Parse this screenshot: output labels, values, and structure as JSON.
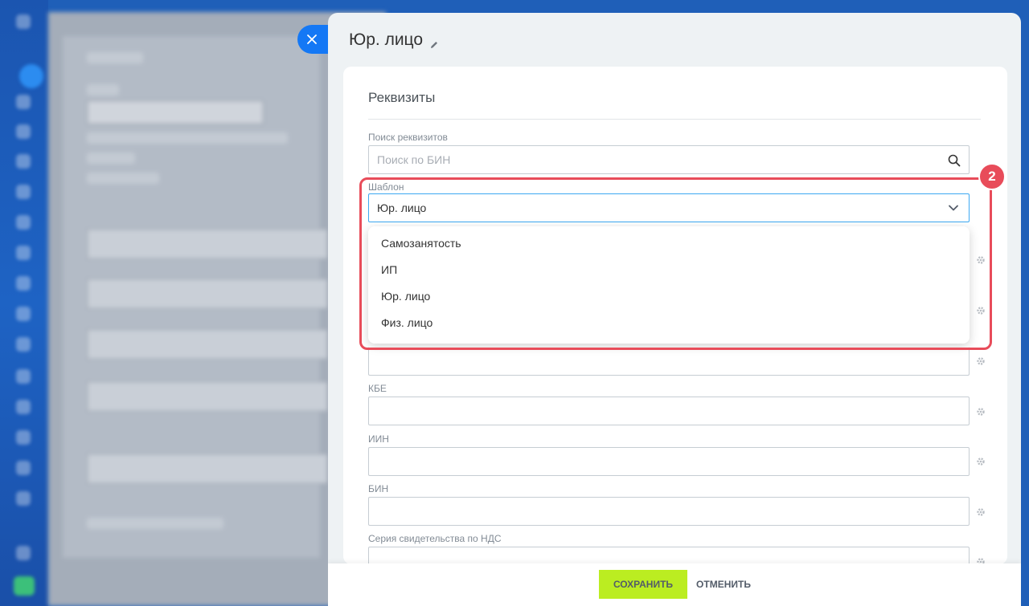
{
  "slider": {
    "title": "Юр. лицо",
    "card_heading": "Реквизиты"
  },
  "search": {
    "label": "Поиск реквизитов",
    "placeholder": "Поиск по БИН"
  },
  "template": {
    "label": "Шаблон",
    "selected": "Юр. лицо",
    "options": [
      "Самозанятость",
      "ИП",
      "Юр. лицо",
      "Физ. лицо"
    ]
  },
  "fields": {
    "kbe": "КБЕ",
    "iin": "ИИН",
    "bin": "БИН",
    "vat_series": "Серия свидетельства по НДС"
  },
  "annotation": {
    "badge": "2",
    "color": "#e84c5a"
  },
  "footer": {
    "save_label": "СОХРАНИТЬ",
    "cancel_label": "ОТМЕНИТЬ"
  },
  "colors": {
    "accent": "#1478f5",
    "save": "#bbed21",
    "select_border": "#3da9f2"
  }
}
